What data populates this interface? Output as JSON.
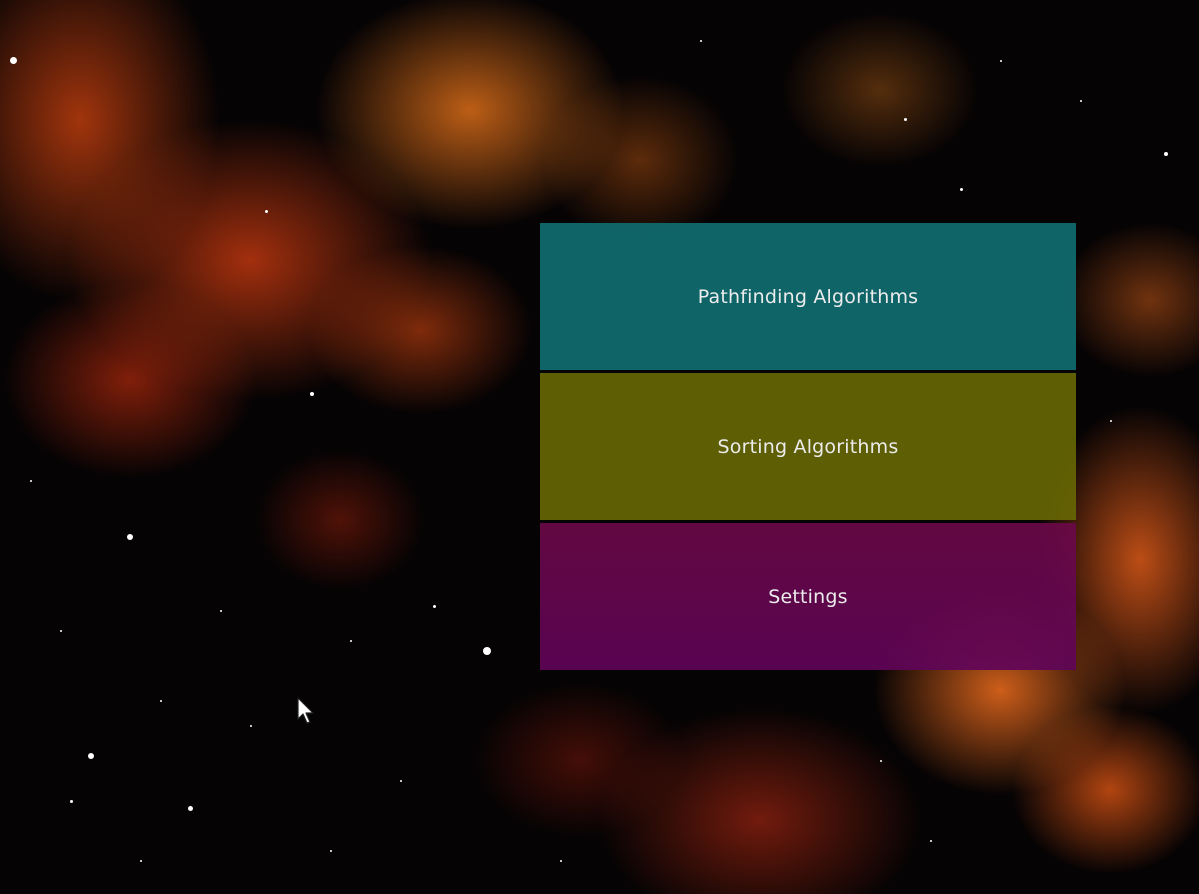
{
  "menu": {
    "items": [
      {
        "label": "Pathfinding Algorithms",
        "color": "#106c70"
      },
      {
        "label": "Sorting Algorithms",
        "color": "#686804"
      },
      {
        "label": "Settings",
        "color": "#6c0848"
      }
    ]
  },
  "background": {
    "icon": "space-nebula-background",
    "colors": [
      "#060304",
      "#c8410f",
      "#dc6e19",
      "#f06e1e"
    ]
  },
  "cursor": {
    "icon": "mouse-pointer-icon"
  }
}
